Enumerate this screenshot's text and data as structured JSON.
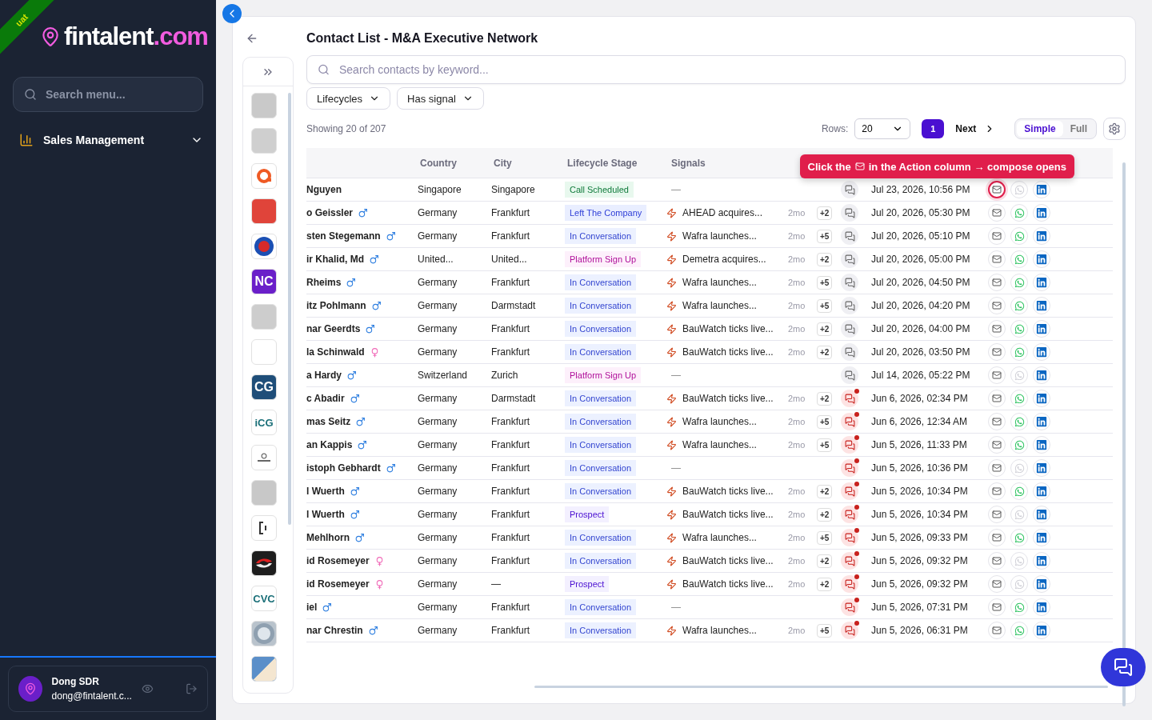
{
  "env_ribbon": "uat",
  "sidebar": {
    "logo": {
      "brand": "fintalent",
      "tld": ".com"
    },
    "search": {
      "placeholder": "Search menu..."
    },
    "items": [
      {
        "label": "Sales Management",
        "expanded": false
      }
    ],
    "user": {
      "name": "Dong SDR",
      "email": "dong@fintalent.c..."
    }
  },
  "page": {
    "title": "Contact List - M&A Executive Network",
    "search": {
      "placeholder": "Search contacts by keyword..."
    },
    "filters": [
      {
        "label": "Lifecycles"
      },
      {
        "label": "Has signal"
      }
    ],
    "showing": "Showing 20 of 207",
    "rows_label": "Rows:",
    "rows_value": "20",
    "pages": [
      {
        "label": "1",
        "selected": true
      }
    ],
    "next": "Next",
    "views": [
      {
        "label": "Simple",
        "selected": true
      },
      {
        "label": "Full",
        "selected": false
      }
    ],
    "tooltip": {
      "before": "Click the",
      "after": "in the Action column → compose opens"
    }
  },
  "logos": [
    {
      "color": "#c9c9c9",
      "kind": "blank"
    },
    {
      "color": "#cfcfcf",
      "kind": "blank"
    },
    {
      "color": "#ffffff",
      "kind": "ring"
    },
    {
      "color": "#e0443a",
      "kind": "blank"
    },
    {
      "color": "#ffffff",
      "kind": "disc"
    },
    {
      "color": "#6a1fc9",
      "kind": "text",
      "text": "NC"
    },
    {
      "color": "#cdcdcd",
      "kind": "blank"
    },
    {
      "color": "#ffffff",
      "kind": "blank"
    },
    {
      "color": "#1f4e79",
      "kind": "text",
      "text": "CG"
    },
    {
      "color": "#ffffff",
      "kind": "text",
      "text": "iCG"
    },
    {
      "color": "#ffffff",
      "kind": "small"
    },
    {
      "color": "#c8c8c8",
      "kind": "blank"
    },
    {
      "color": "#ffffff",
      "kind": "bracket"
    },
    {
      "color": "#1e1e1e",
      "kind": "swirl"
    },
    {
      "color": "#ffffff",
      "kind": "text",
      "text": "CVC"
    },
    {
      "color": "#b9c3cc",
      "kind": "globe"
    },
    {
      "color": "#5b8fc9",
      "kind": "fold"
    }
  ],
  "table": {
    "columns": [
      "Country",
      "City",
      "Lifecycle Stage",
      "Signals"
    ],
    "rows": [
      {
        "name": "Nguyen",
        "country": "Singapore",
        "city": "Singapore",
        "stage": {
          "label": "Call Scheduled",
          "color": "#0f7a3a"
        },
        "signal": "—",
        "chat_unread": false,
        "date": "Jul 23, 2026, 10:56 PM",
        "email_highlighted": true,
        "whatsapp": false
      },
      {
        "name": "o Geissler",
        "gender": {
          "kind": "male"
        },
        "country": "Germany",
        "city": "Frankfurt",
        "stage": {
          "label": "Left The Company",
          "color": "#3040d8"
        },
        "signal": "AHEAD acquires...",
        "age": "2mo",
        "more": "+2",
        "chat_unread": false,
        "date": "Jul 20, 2026, 05:30 PM",
        "email_highlighted": false,
        "whatsapp": true
      },
      {
        "name": "sten Stegemann",
        "gender": {
          "kind": "male"
        },
        "country": "Germany",
        "city": "Frankfurt",
        "stage": {
          "label": "In Conversation",
          "color": "#3446d0"
        },
        "signal": "Wafra launches...",
        "age": "2mo",
        "more": "+5",
        "chat_unread": false,
        "date": "Jul 20, 2026, 05:10 PM",
        "email_highlighted": false,
        "whatsapp": true
      },
      {
        "name": "ir Khalid, Md",
        "gender": {
          "kind": "male"
        },
        "country": "United...",
        "city": "United...",
        "stage": {
          "label": "Platform Sign Up",
          "color": "#b0109a"
        },
        "signal": "Demetra acquires...",
        "age": "2mo",
        "more": "+2",
        "chat_unread": false,
        "date": "Jul 20, 2026, 05:00 PM",
        "email_highlighted": false,
        "whatsapp": true
      },
      {
        "name": "Rheims",
        "gender": {
          "kind": "male"
        },
        "country": "Germany",
        "city": "Frankfurt",
        "stage": {
          "label": "In Conversation",
          "color": "#3446d0"
        },
        "signal": "Wafra launches...",
        "age": "2mo",
        "more": "+5",
        "chat_unread": false,
        "date": "Jul 20, 2026, 04:50 PM",
        "email_highlighted": false,
        "whatsapp": true
      },
      {
        "name": "itz Pohlmann",
        "gender": {
          "kind": "male"
        },
        "country": "Germany",
        "city": "Darmstadt",
        "stage": {
          "label": "In Conversation",
          "color": "#3446d0"
        },
        "signal": "Wafra launches...",
        "age": "2mo",
        "more": "+5",
        "chat_unread": false,
        "date": "Jul 20, 2026, 04:20 PM",
        "email_highlighted": false,
        "whatsapp": true
      },
      {
        "name": "nar Geerdts",
        "gender": {
          "kind": "male"
        },
        "country": "Germany",
        "city": "Frankfurt",
        "stage": {
          "label": "In Conversation",
          "color": "#3446d0"
        },
        "signal": "BauWatch ticks live...",
        "age": "2mo",
        "more": "+2",
        "chat_unread": false,
        "date": "Jul 20, 2026, 04:00 PM",
        "email_highlighted": false,
        "whatsapp": true
      },
      {
        "name": "la Schinwald",
        "gender": {
          "kind": "female"
        },
        "country": "Germany",
        "city": "Frankfurt",
        "stage": {
          "label": "In Conversation",
          "color": "#3446d0"
        },
        "signal": "BauWatch ticks live...",
        "age": "2mo",
        "more": "+2",
        "chat_unread": false,
        "date": "Jul 20, 2026, 03:50 PM",
        "email_highlighted": false,
        "whatsapp": true
      },
      {
        "name": "a Hardy",
        "gender": {
          "kind": "male"
        },
        "country": "Switzerland",
        "city": "Zurich",
        "stage": {
          "label": "Platform Sign Up",
          "color": "#b0109a"
        },
        "signal": "—",
        "chat_unread": false,
        "date": "Jul 14, 2026, 05:22 PM",
        "email_highlighted": false,
        "whatsapp": false
      },
      {
        "name": "c Abadir",
        "gender": {
          "kind": "male"
        },
        "country": "Germany",
        "city": "Darmstadt",
        "stage": {
          "label": "In Conversation",
          "color": "#3446d0"
        },
        "signal": "BauWatch ticks live...",
        "age": "2mo",
        "more": "+2",
        "chat_unread": true,
        "date": "Jun 6, 2026, 02:34 PM",
        "email_highlighted": false,
        "whatsapp": true
      },
      {
        "name": "mas Seitz",
        "gender": {
          "kind": "male"
        },
        "country": "Germany",
        "city": "Frankfurt",
        "stage": {
          "label": "In Conversation",
          "color": "#3446d0"
        },
        "signal": "Wafra launches...",
        "age": "2mo",
        "more": "+5",
        "chat_unread": true,
        "date": "Jun 6, 2026, 12:34 AM",
        "email_highlighted": false,
        "whatsapp": true
      },
      {
        "name": "an Kappis",
        "gender": {
          "kind": "male"
        },
        "country": "Germany",
        "city": "Frankfurt",
        "stage": {
          "label": "In Conversation",
          "color": "#3446d0"
        },
        "signal": "Wafra launches...",
        "age": "2mo",
        "more": "+5",
        "chat_unread": true,
        "date": "Jun 5, 2026, 11:33 PM",
        "email_highlighted": false,
        "whatsapp": true
      },
      {
        "name": "istoph Gebhardt",
        "gender": {
          "kind": "male"
        },
        "country": "Germany",
        "city": "Frankfurt",
        "stage": {
          "label": "In Conversation",
          "color": "#3446d0"
        },
        "signal": "—",
        "chat_unread": true,
        "date": "Jun 5, 2026, 10:36 PM",
        "email_highlighted": false,
        "whatsapp": false
      },
      {
        "name": "l Wuerth",
        "gender": {
          "kind": "male"
        },
        "country": "Germany",
        "city": "Frankfurt",
        "stage": {
          "label": "In Conversation",
          "color": "#3446d0"
        },
        "signal": "BauWatch ticks live...",
        "age": "2mo",
        "more": "+2",
        "chat_unread": true,
        "date": "Jun 5, 2026, 10:34 PM",
        "email_highlighted": false,
        "whatsapp": true
      },
      {
        "name": "l Wuerth",
        "gender": {
          "kind": "male"
        },
        "country": "Germany",
        "city": "Frankfurt",
        "stage": {
          "label": "Prospect",
          "color": "#4a0fd1"
        },
        "signal": "BauWatch ticks live...",
        "age": "2mo",
        "more": "+2",
        "chat_unread": true,
        "date": "Jun 5, 2026, 10:34 PM",
        "email_highlighted": false,
        "whatsapp": false
      },
      {
        "name": "Mehlhorn",
        "gender": {
          "kind": "male"
        },
        "country": "Germany",
        "city": "Frankfurt",
        "stage": {
          "label": "In Conversation",
          "color": "#3446d0"
        },
        "signal": "Wafra launches...",
        "age": "2mo",
        "more": "+5",
        "chat_unread": true,
        "date": "Jun 5, 2026, 09:33 PM",
        "email_highlighted": false,
        "whatsapp": true
      },
      {
        "name": "id Rosemeyer",
        "gender": {
          "kind": "female"
        },
        "country": "Germany",
        "city": "Frankfurt",
        "stage": {
          "label": "In Conversation",
          "color": "#3446d0"
        },
        "signal": "BauWatch ticks live...",
        "age": "2mo",
        "more": "+2",
        "chat_unread": true,
        "date": "Jun 5, 2026, 09:32 PM",
        "email_highlighted": false,
        "whatsapp": false
      },
      {
        "name": "id Rosemeyer",
        "gender": {
          "kind": "female"
        },
        "country": "Germany",
        "city": "—",
        "stage": {
          "label": "Prospect",
          "color": "#4a0fd1"
        },
        "signal": "BauWatch ticks live...",
        "age": "2mo",
        "more": "+2",
        "chat_unread": true,
        "date": "Jun 5, 2026, 09:32 PM",
        "email_highlighted": false,
        "whatsapp": false
      },
      {
        "name": "iel",
        "gender": {
          "kind": "male"
        },
        "country": "Germany",
        "city": "Frankfurt",
        "stage": {
          "label": "In Conversation",
          "color": "#3446d0"
        },
        "signal": "—",
        "chat_unread": true,
        "date": "Jun 5, 2026, 07:31 PM",
        "email_highlighted": false,
        "whatsapp": true
      },
      {
        "name": "nar Chrestin",
        "gender": {
          "kind": "male"
        },
        "country": "Germany",
        "city": "Frankfurt",
        "stage": {
          "label": "In Conversation",
          "color": "#3446d0"
        },
        "signal": "Wafra launches...",
        "age": "2mo",
        "more": "+5",
        "chat_unread": true,
        "date": "Jun 5, 2026, 06:31 PM",
        "email_highlighted": false,
        "whatsapp": true
      }
    ]
  }
}
